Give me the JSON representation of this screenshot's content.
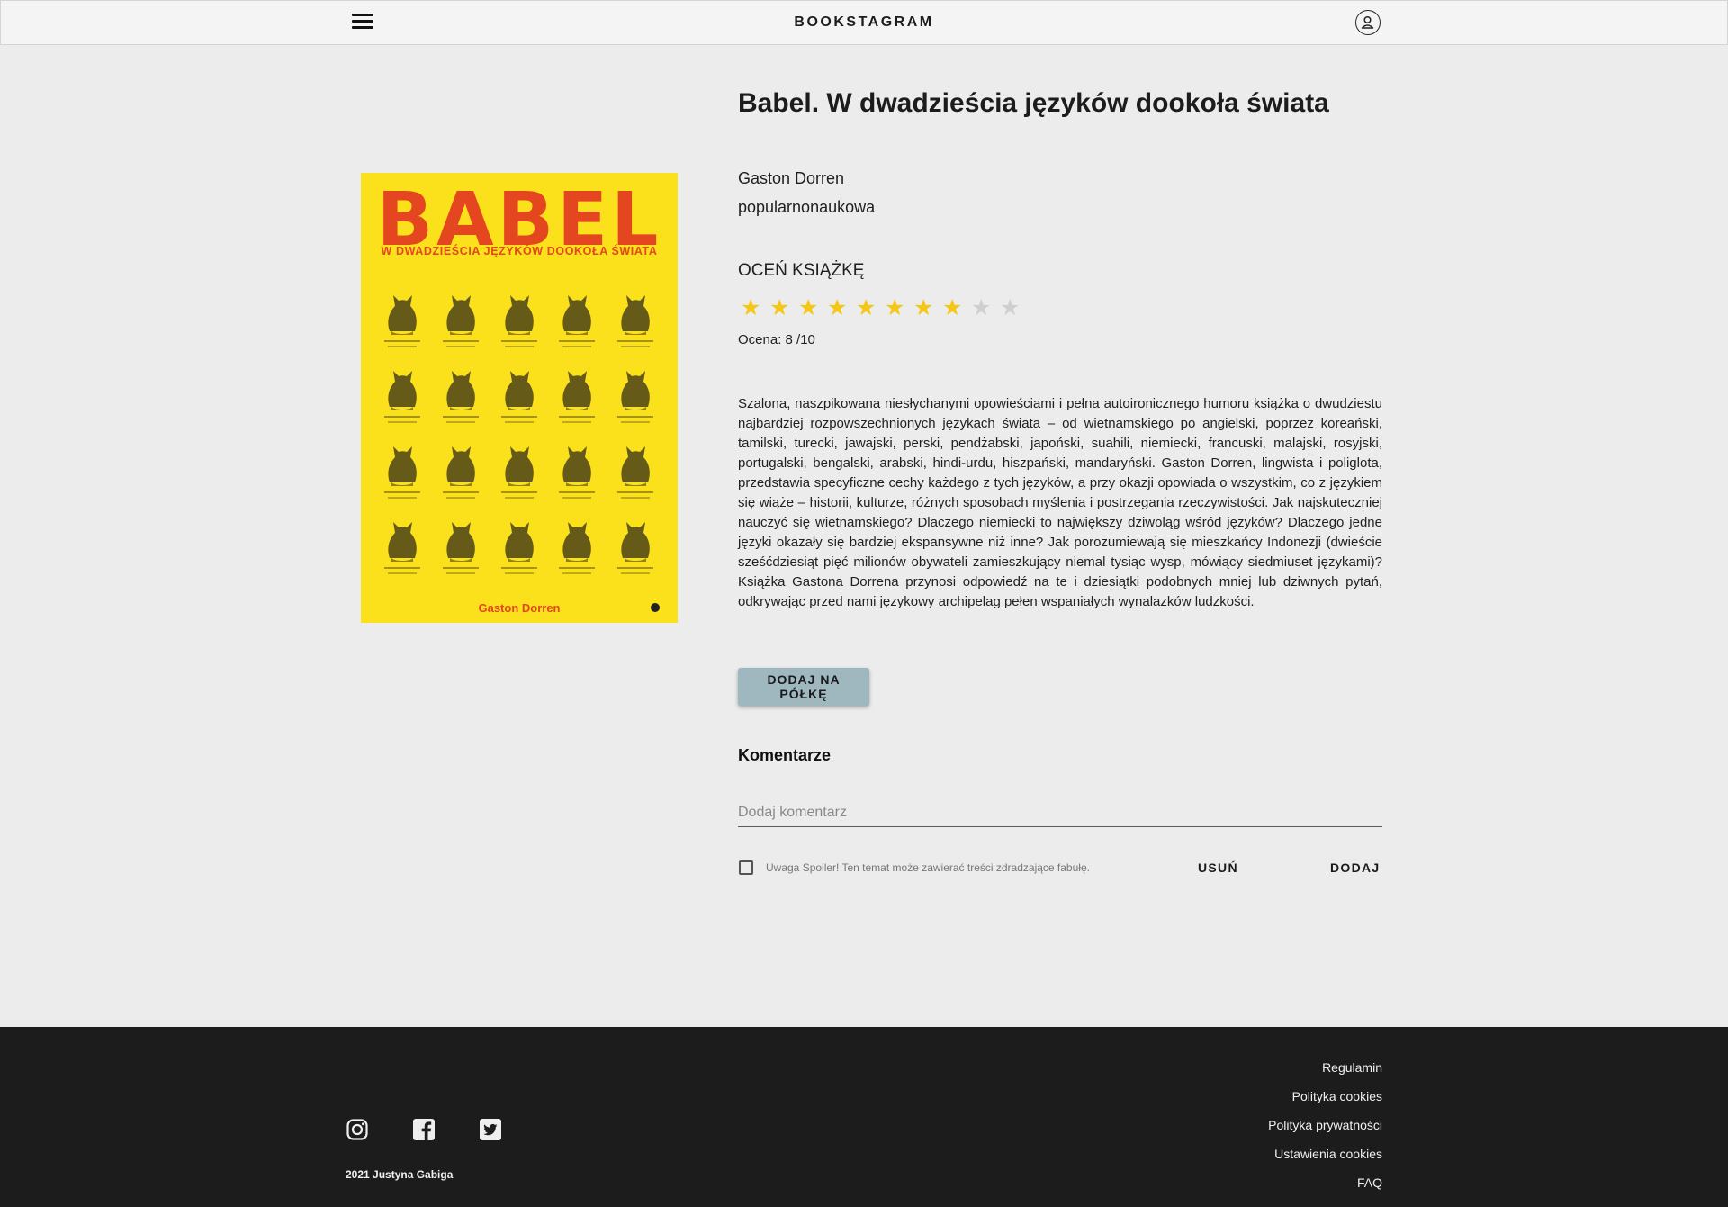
{
  "header": {
    "brand": "BOOKSTAGRAM",
    "icons": [
      "hamburger-menu-icon",
      "user-account-icon"
    ]
  },
  "book": {
    "title": "Babel. W dwadzieścia języków dookoła świata",
    "author": "Gaston Dorren",
    "genre": "popularnonaukowa",
    "cover": {
      "title": "BABEL",
      "subtitle": "W DWADZIEŚCIA JĘZYKÓW DOOKOŁA ŚWIATA",
      "author": "Gaston Dorren",
      "background_color": "#fbe11b",
      "text_color": "#e4461f"
    },
    "description": "Szalona, naszpikowana niesłychanymi opowieściami i pełna autoironicznego humoru książka o dwudziestu najbardziej rozpowszechnionych językach świata – od wietnamskiego po angielski, poprzez koreański, tamilski, turecki, jawajski, perski, pendżabski, japoński, suahili, niemiecki, francuski, malajski, rosyjski, portugalski, bengalski, arabski, hindi-urdu, hiszpański, mandaryński. Gaston Dorren, lingwista i poliglota, przedstawia specyficzne cechy każdego z tych języków, a przy okazji opowiada o wszystkim, co z językiem się wiąże – historii, kulturze, różnych sposobach myślenia i postrzegania rzeczywistości. Jak najskuteczniej nauczyć się wietnamskiego? Dlaczego niemiecki to największy dziwoląg wśród języków? Dlaczego jedne języki okazały się bardziej ekspansywne niż inne? Jak porozumiewają się mieszkańcy Indonezji (dwieście sześćdziesiąt pięć milionów obywateli zamieszkujący niemal tysiąc wysp, mówiący siedmiuset językami)? Książka Gastona Dorrena przynosi odpowiedź na te i dziesiątki podobnych mniej lub dziwnych pytań, odkrywając przed nami językowy archipelag pełen wspaniałych wynalazków ludzkości."
  },
  "rating": {
    "heading": "OCEŃ KSIĄŻKĘ",
    "value": 8,
    "max": 10,
    "label": "Ocena: 8 /10",
    "filled_color": "#f5c518",
    "empty_color": "#cfcfcf"
  },
  "actions": {
    "add_to_shelf": "DODAJ NA PÓŁKĘ"
  },
  "comments": {
    "heading": "Komentarze",
    "placeholder": "Dodaj komentarz",
    "value": "",
    "spoiler_checked": false,
    "spoiler_label": "Uwaga Spoiler! Ten temat może zawierać treści zdradzające fabułę.",
    "delete_label": "USUŃ",
    "add_label": "DODAJ"
  },
  "footer": {
    "social_icons": [
      "instagram-icon",
      "facebook-icon",
      "twitter-icon"
    ],
    "copyright": "2021 Justyna Gabiga",
    "links": [
      "Regulamin",
      "Polityka cookies",
      "Polityka prywatności",
      "Ustawienia cookies",
      "FAQ"
    ]
  }
}
